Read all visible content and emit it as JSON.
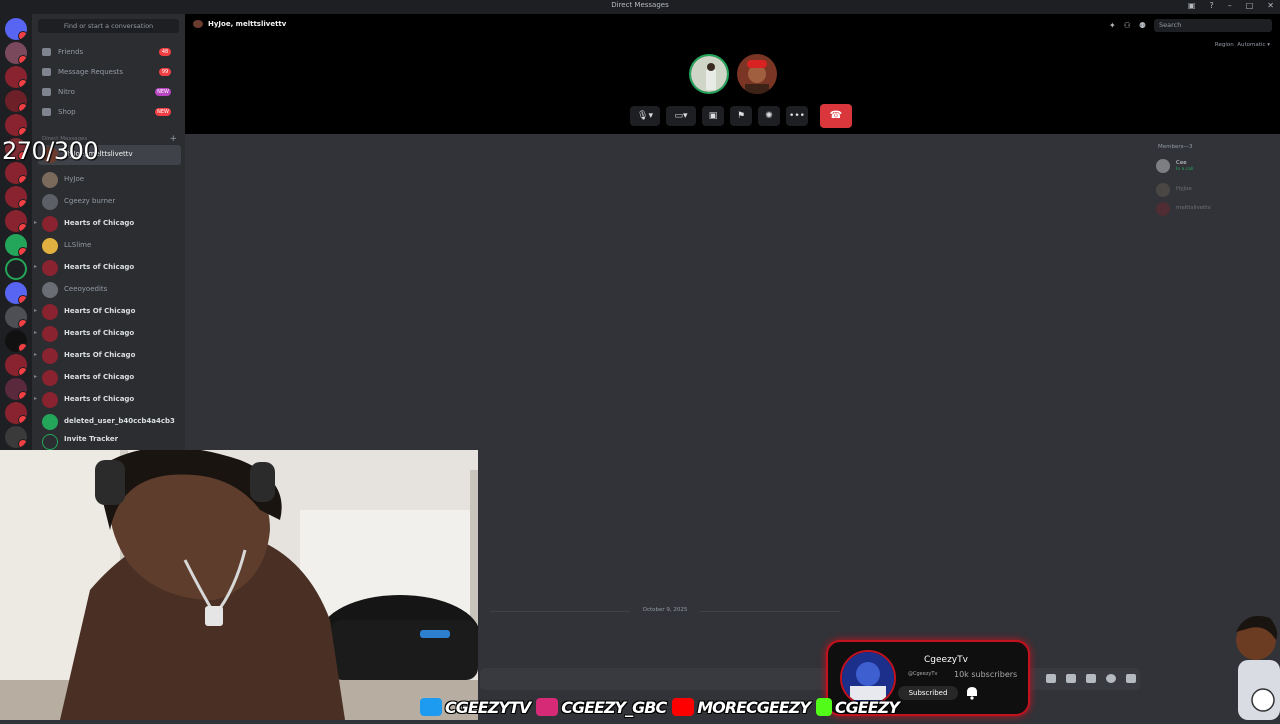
{
  "window": {
    "title": "Direct Messages"
  },
  "sidebar": {
    "find_placeholder": "Find or start a conversation",
    "nav": [
      {
        "label": "Friends",
        "badge": "48"
      },
      {
        "label": "Message Requests",
        "badge": "99"
      },
      {
        "label": "Nitro",
        "badge": "NEW"
      },
      {
        "label": "Shop",
        "badge": "NEW"
      }
    ],
    "section_label": "Direct Messages",
    "dms": [
      {
        "name": "HyJoe, melttslivettv",
        "group": false
      },
      {
        "name": "HyJoe",
        "group": false
      },
      {
        "name": "Cgeezy burner",
        "group": false
      },
      {
        "name": "Hearts of Chicago",
        "group": true
      },
      {
        "name": "LLSlime",
        "group": false
      },
      {
        "name": "Hearts of Chicago",
        "group": true
      },
      {
        "name": "Ceeoyoedits",
        "group": false
      },
      {
        "name": "Hearts Of Chicago",
        "group": true
      },
      {
        "name": "Hearts of Chicago",
        "group": true
      },
      {
        "name": "Hearts Of Chicago",
        "group": true
      },
      {
        "name": "Hearts of Chicago",
        "group": true
      },
      {
        "name": "Hearts of Chicago",
        "group": true
      },
      {
        "name": "deleted_user_b40ccb4a4cb3",
        "group": true
      },
      {
        "name": "Invite Tracker",
        "group": true
      }
    ]
  },
  "overlay_counter": "270/300",
  "call": {
    "header": "HyJoe, melttslivettv",
    "search_placeholder": "Search",
    "region_label": "Region",
    "region_value": "Automatic"
  },
  "members": {
    "header": "Members—3",
    "list": [
      {
        "name": "Cee",
        "status": "In a call"
      },
      {
        "name": "HyJoe",
        "status": ""
      },
      {
        "name": "melttslivettv",
        "status": ""
      }
    ]
  },
  "date_divider": "October 9, 2025",
  "sub_card": {
    "channel": "CgeezyTv",
    "handle": "@CgeezyTv",
    "subscribers": "10k subscribers",
    "button": "Subscribed"
  },
  "socials": [
    {
      "platform": "twitter",
      "handle": "CGEEZYTV",
      "color": "#1d9bf0"
    },
    {
      "platform": "instagram",
      "handle": "CGEEZY_GBC",
      "color": "#d62976"
    },
    {
      "platform": "youtube",
      "handle": "MORECGEEZY",
      "color": "#ff0000"
    },
    {
      "platform": "kick",
      "handle": "CGEEZY",
      "color": "#53fc18"
    }
  ]
}
